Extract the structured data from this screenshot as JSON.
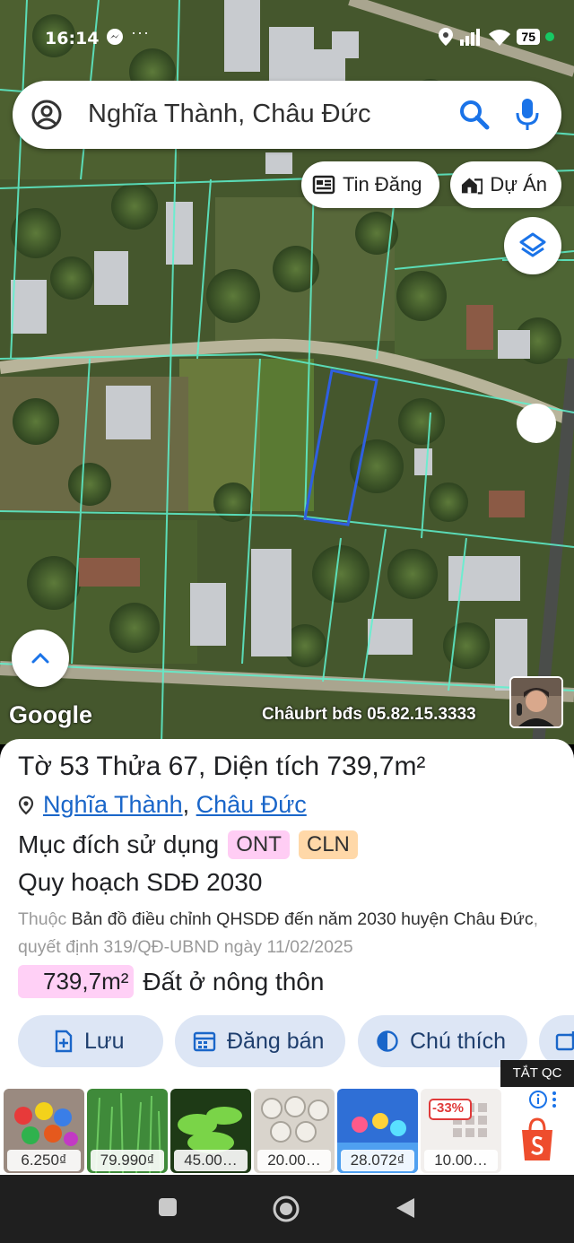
{
  "status_bar": {
    "time": "16:14",
    "battery": "75"
  },
  "search": {
    "query": "Nghĩa Thành, Châu Đức"
  },
  "map_chips": [
    {
      "label": "Tin Đăng",
      "icon": "news-icon"
    },
    {
      "label": "Dự Án",
      "icon": "project-icon"
    }
  ],
  "map": {
    "logo": "Google",
    "watermark": "Châubrt bđs 05.82.15.3333"
  },
  "parcel": {
    "title": "Tờ 53 Thửa 67, Diện tích 739,7m²",
    "commune": "Nghĩa Thành",
    "district": "Châu Đức",
    "separator": ",",
    "purpose_label": "Mục đích sử dụng",
    "purpose_tags": [
      "ONT",
      "CLN"
    ],
    "plan_title": "Quy hoạch SDĐ 2030",
    "plan_prefix": "Thuộc",
    "plan_doc": "Bản đồ điều chỉnh QHSDĐ đến năm 2030 huyện Châu Đức",
    "plan_decision": ", quyết định 319/QĐ-UBND ngày 11/02/2025",
    "area_value": "739,7m²",
    "area_label": "Đất ở nông thôn"
  },
  "actions": [
    {
      "label": "Lưu",
      "icon": "bookmark-add-icon"
    },
    {
      "label": "Đăng bán",
      "icon": "calendar-icon"
    },
    {
      "label": "Chú thích",
      "icon": "contrast-icon"
    }
  ],
  "ads": {
    "close_label": "TẮT QC",
    "discount_label": "-33%",
    "items": [
      {
        "price": "6.250₫"
      },
      {
        "price": "79.990₫"
      },
      {
        "price": "45.00…"
      },
      {
        "price": "20.00…"
      },
      {
        "price": "28.072₫"
      },
      {
        "price": "10.00…"
      }
    ]
  },
  "colors": {
    "link": "#1a66c9",
    "button_bg": "#dde6f5",
    "parcel_line": "#5ef2cf",
    "selected_parcel": "#2f5fe0",
    "ont_tag": "#ffcdf4",
    "cln_tag": "#ffd8a8"
  }
}
